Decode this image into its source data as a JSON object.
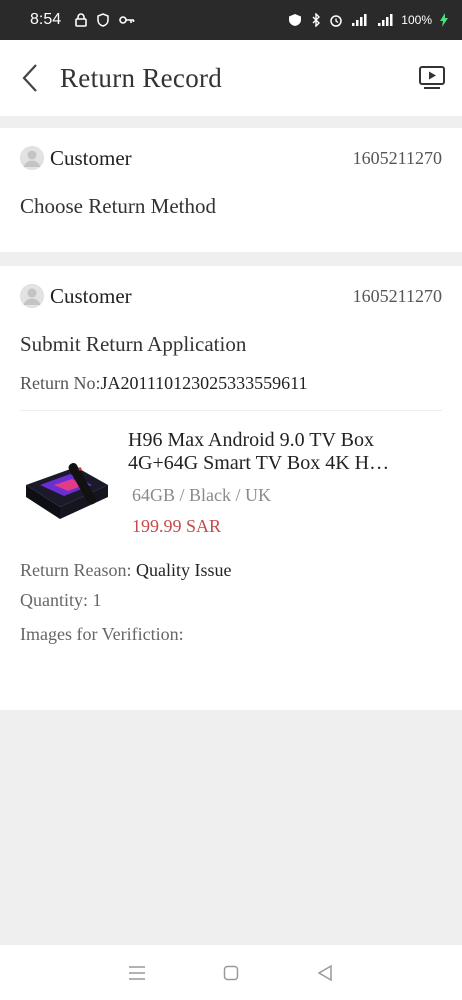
{
  "status_bar": {
    "time": "8:54",
    "battery": "100%"
  },
  "header": {
    "title": "Return Record"
  },
  "records": [
    {
      "user": "Customer",
      "phone": "1605211270",
      "stage": "Choose Return Method"
    },
    {
      "user": "Customer",
      "phone": "1605211270",
      "stage": "Submit Return Application",
      "return_no_label": "Return No:",
      "return_no": "JA20111012302533355961​1",
      "product": {
        "name": "H96 Max Android 9.0 TV Box 4G+64G Smart TV Box 4K H…",
        "spec": "64GB / Black / UK",
        "price": "199.99 SAR"
      },
      "reason_label": "Return Reason:",
      "reason": "Quality Issue",
      "quantity": "Quantity: 1",
      "images_label": "Images for Verifiction:"
    }
  ],
  "colors": {
    "price": "#c74a4a",
    "background": "#efefef"
  }
}
